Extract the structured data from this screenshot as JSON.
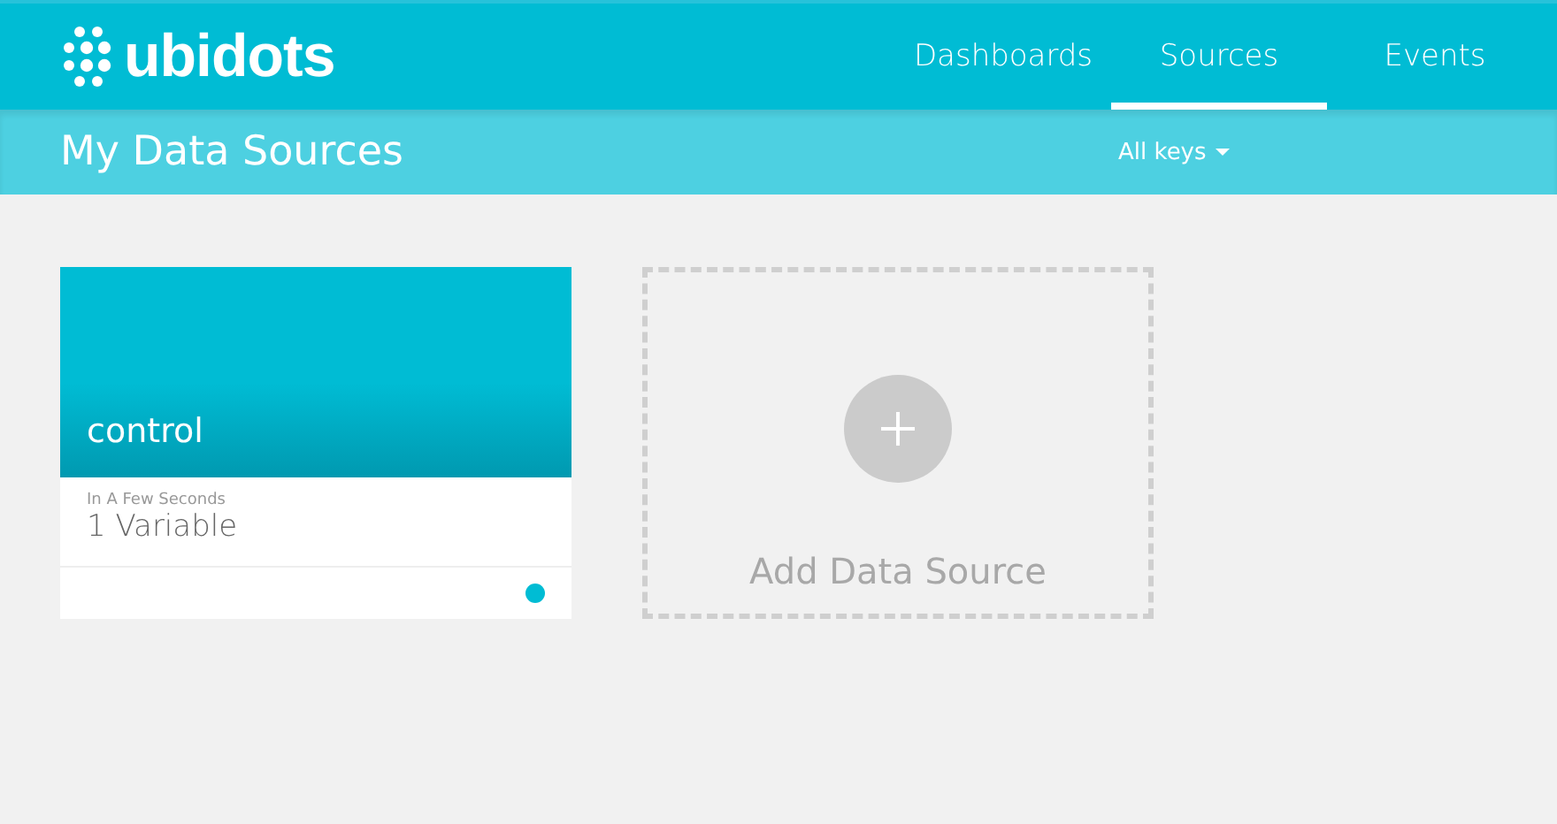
{
  "header": {
    "logo": "ubidots",
    "nav": [
      {
        "label": "Dashboards",
        "selected": false
      },
      {
        "label": "Sources",
        "selected": true
      },
      {
        "label": "Events",
        "selected": false
      }
    ]
  },
  "subheader": {
    "title": "My Data Sources",
    "filter": "All keys"
  },
  "sources": [
    {
      "name": "control",
      "last_activity": "In A Few Seconds",
      "variables": "1 Variable"
    }
  ],
  "add_card": {
    "label": "Add Data Source"
  }
}
